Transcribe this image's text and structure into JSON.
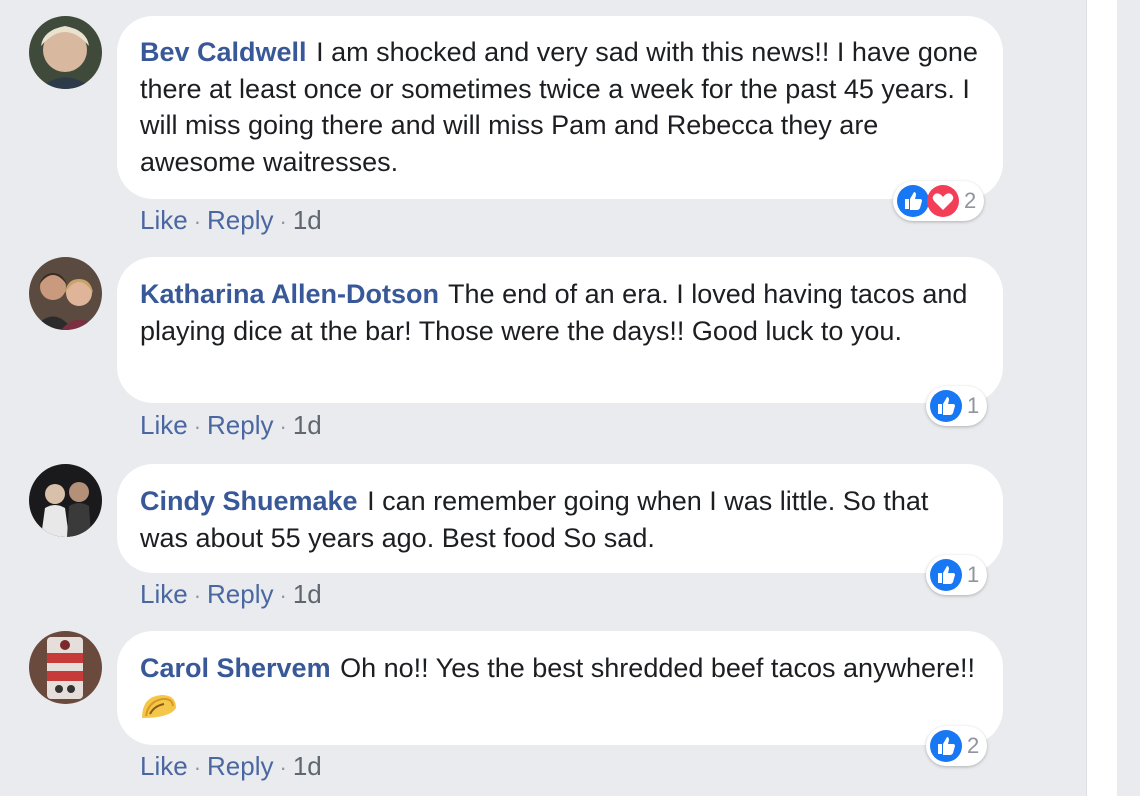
{
  "comments": [
    {
      "author": "Bev Caldwell",
      "text": "I am shocked and very sad with this news!! I have gone there at least once or sometimes twice a week for the past 45 years. I will miss going there and will miss Pam and Rebecca they are awesome waitresses.",
      "like_label": "Like",
      "reply_label": "Reply",
      "time": "1d",
      "reaction_icons": [
        "like-icon",
        "love-icon"
      ],
      "reaction_count": "2"
    },
    {
      "author": "Katharina Allen-Dotson",
      "text": "The end of an era. I loved having tacos and playing dice at the bar! Those were the days!! Good luck to you.",
      "like_label": "Like",
      "reply_label": "Reply",
      "time": "1d",
      "reaction_icons": [
        "like-icon"
      ],
      "reaction_count": "1"
    },
    {
      "author": "Cindy Shuemake",
      "text": "I can remember going when I was little. So that was about 55 years ago. Best food So sad.",
      "like_label": "Like",
      "reply_label": "Reply",
      "time": "1d",
      "reaction_icons": [
        "like-icon"
      ],
      "reaction_count": "1"
    },
    {
      "author": "Carol Shervem",
      "text": "Oh no!! Yes the best shredded beef tacos anywhere!!",
      "emoji": "taco-icon",
      "like_label": "Like",
      "reply_label": "Reply",
      "time": "1d",
      "reaction_icons": [
        "like-icon"
      ],
      "reaction_count": "2"
    }
  ],
  "colors": {
    "author_link": "#385898",
    "like_blue": "#1877f2",
    "love_red": "#f33e58",
    "background": "#e9ebee"
  }
}
